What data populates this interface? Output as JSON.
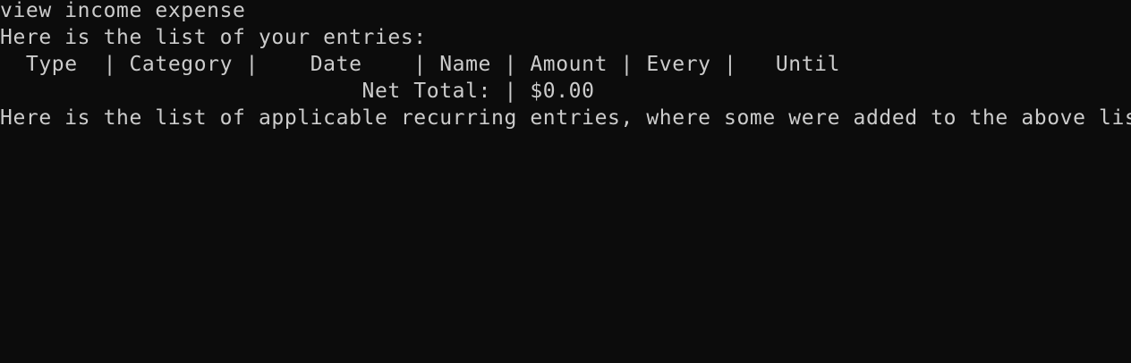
{
  "terminal": {
    "colors": {
      "background": "#0c0c0c",
      "foreground": "#cccccc"
    },
    "lines": [
      "view income expense",
      "Here is the list of your entries:",
      "  Type  | Category |    Date    | Name | Amount | Every |   Until",
      "                            Net Total: | $0.00",
      "Here is the list of applicable recurring entries, where some were added to the above list:"
    ]
  }
}
